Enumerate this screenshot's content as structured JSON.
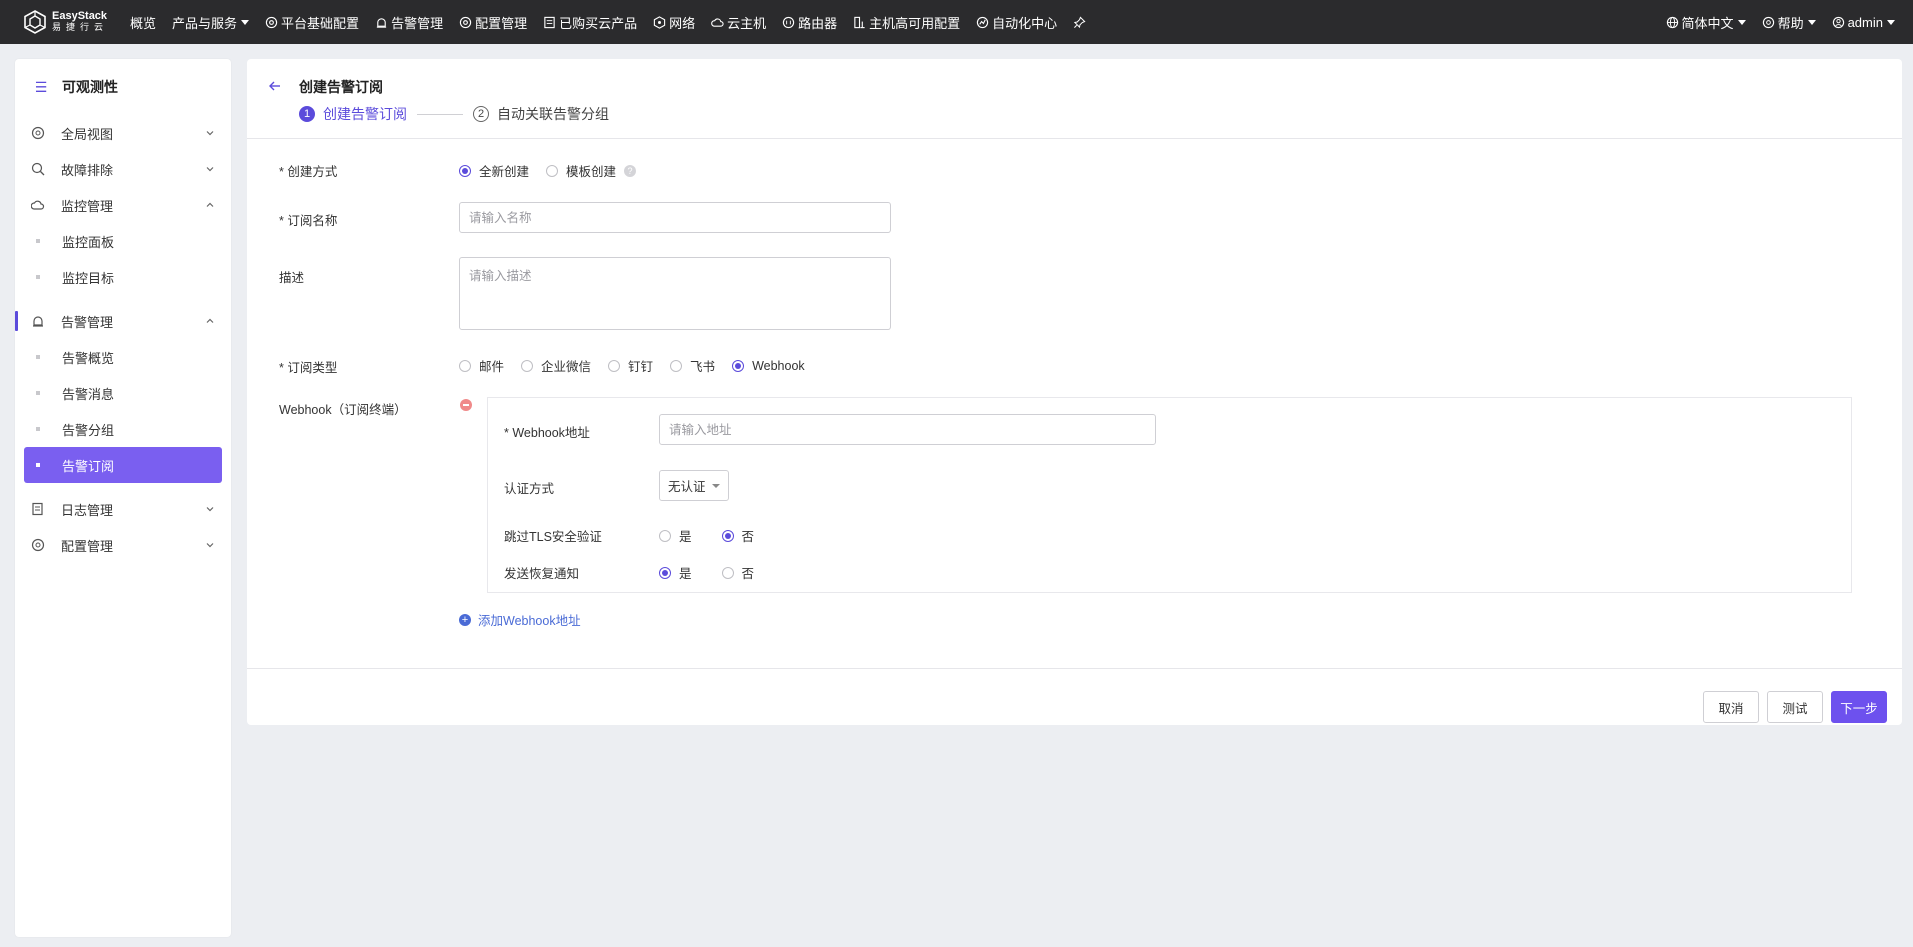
{
  "brand": {
    "name_en": "EasyStack",
    "name_cn": "易捷行云"
  },
  "topnav": [
    {
      "label": "概览",
      "icon": ""
    },
    {
      "label": "产品与服务",
      "icon": "",
      "dropdown": true
    },
    {
      "label": "平台基础配置",
      "icon": "gear-icon"
    },
    {
      "label": "告警管理",
      "icon": "alarm-icon"
    },
    {
      "label": "配置管理",
      "icon": "gear-icon"
    },
    {
      "label": "已购买云产品",
      "icon": "list-icon"
    },
    {
      "label": "网络",
      "icon": "network-icon"
    },
    {
      "label": "云主机",
      "icon": "cloud-icon"
    },
    {
      "label": "路由器",
      "icon": "router-icon"
    },
    {
      "label": "主机高可用配置",
      "icon": "host-icon"
    },
    {
      "label": "自动化中心",
      "icon": "automation-icon"
    }
  ],
  "topright": {
    "language": "简体中文",
    "help": "帮助",
    "user": "admin"
  },
  "sidebar": {
    "title": "可观测性",
    "groups": [
      {
        "label": "全局视图",
        "icon": "globe-icon",
        "expanded": false,
        "items": []
      },
      {
        "label": "故障排除",
        "icon": "troubleshoot-icon",
        "expanded": false,
        "items": []
      },
      {
        "label": "监控管理",
        "icon": "monitor-icon",
        "expanded": true,
        "items": [
          "监控面板",
          "监控目标"
        ]
      },
      {
        "label": "告警管理",
        "icon": "alarm-icon",
        "expanded": true,
        "items": [
          "告警概览",
          "告警消息",
          "告警分组",
          "告警订阅"
        ]
      },
      {
        "label": "日志管理",
        "icon": "log-icon",
        "expanded": false,
        "items": []
      },
      {
        "label": "配置管理",
        "icon": "gear-icon",
        "expanded": false,
        "items": []
      }
    ],
    "selected_item": "告警订阅"
  },
  "page": {
    "title": "创建告警订阅",
    "steps": [
      {
        "num": "1",
        "label": "创建告警订阅",
        "active": true
      },
      {
        "num": "2",
        "label": "自动关联告警分组",
        "active": false
      }
    ]
  },
  "form": {
    "create_mode": {
      "label": "* 创建方式",
      "options": [
        "全新创建",
        "模板创建"
      ],
      "selected": "全新创建"
    },
    "name": {
      "label": "* 订阅名称",
      "placeholder": "请输入名称",
      "value": ""
    },
    "desc": {
      "label": "描述",
      "placeholder": "请输入描述",
      "value": ""
    },
    "type": {
      "label": "* 订阅类型",
      "options": [
        "邮件",
        "企业微信",
        "钉钉",
        "飞书",
        "Webhook"
      ],
      "selected": "Webhook"
    },
    "webhook": {
      "label": "Webhook（订阅终端）",
      "url_label": "* Webhook地址",
      "url_placeholder": "请输入地址",
      "auth_label": "认证方式",
      "auth_value": "无认证",
      "skip_tls_label": "跳过TLS安全验证",
      "skip_tls_options": [
        "是",
        "否"
      ],
      "skip_tls_selected": "否",
      "recover_label": "发送恢复通知",
      "recover_options": [
        "是",
        "否"
      ],
      "recover_selected": "是",
      "add_label": "添加Webhook地址"
    }
  },
  "footer": {
    "cancel": "取消",
    "test": "测试",
    "next": "下一步"
  },
  "colors": {
    "accent": "#5b4bdb",
    "primary_button": "#6d51ee",
    "link": "#4a6bd6",
    "topbar": "#2b2b2d"
  }
}
